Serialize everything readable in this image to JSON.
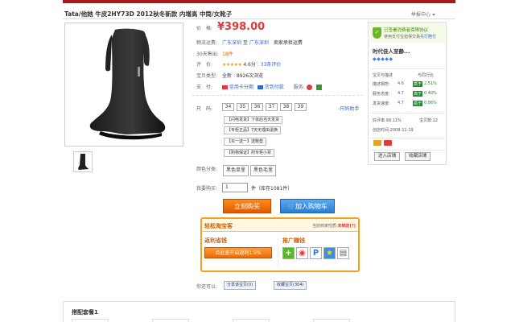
{
  "product": {
    "title": "Tata/他她 牛皮2HY73D 2012秋冬新款 内增高 中筒/女靴子",
    "report": "举报中心"
  },
  "price": {
    "label": "价　格:",
    "value": "¥398.00"
  },
  "shipping": {
    "label": "物流运费:",
    "from": "广东深圳",
    "to_prefix": "至",
    "to": "广东深圳",
    "note": "卖家承担运费"
  },
  "sales": {
    "label": "30天售出:",
    "value": "18件"
  },
  "rating": {
    "label": "评　价:",
    "stars": "★★★★★",
    "score": "4.6分",
    "reviews": "33条评价"
  },
  "points": {
    "label": "宝贝类型:",
    "value": "全新",
    "extra": "8926次浏览"
  },
  "payment": {
    "label": "支　付:",
    "credit": "信用卡分期",
    "installment": "货到付款",
    "service_label": "服务:"
  },
  "size": {
    "label": "尺　码:",
    "options": [
      "34",
      "35",
      "36",
      "37",
      "38",
      "39"
    ],
    "chart_link": "尺码助手"
  },
  "tags": [
    "【闪电发货】下单后当天发货",
    "【专柜正品】7天无理由退换",
    "【买一送一】送鞋垫",
    "【购物保证】附专柜小票"
  ],
  "color": {
    "label": "颜色分类:",
    "options": [
      "黑色单里",
      "黑色毛里"
    ]
  },
  "quantity": {
    "label": "我要购买:",
    "value": "1",
    "stock": "件（库存1081件）"
  },
  "buttons": {
    "buy_now": "立刻购买",
    "add_cart": "加入购物车"
  },
  "promo": {
    "title": "轻松淘宝客",
    "status_prefix": "当前商家性质:",
    "status": "未绑定(?)",
    "rebate_title": "返利省钱",
    "rebate_button": "点此查开启返利1.5%",
    "share_title": "推广赚钱"
  },
  "share": {
    "label": "你还可以:",
    "share_btn": "分享该宝贝(0)",
    "fav_btn": "收藏宝贝(304)"
  },
  "seller": {
    "guarantee_title": "已签署消费者保障协议",
    "guarantee_sub": "使用支付宝担保交易",
    "guarantee_link": "先行赔付",
    "name": "时代佳人至静...",
    "diamonds": "◆◆◆◆◆",
    "header_col1": "宝贝与描述",
    "header_col2": "与同行比",
    "rows": [
      {
        "name": "描述相符:",
        "score": "4.6",
        "badge": "高于",
        "pct": "2.51%"
      },
      {
        "name": "服务态度:",
        "score": "4.7",
        "badge": "高于",
        "pct": "0.40%"
      },
      {
        "name": "发货速度:",
        "score": "4.7",
        "badge": "高于",
        "pct": "0.86%"
      }
    ],
    "rate": "好评率:98.11%",
    "dsr": "宝贝数:12",
    "since": "创店时间:2008-11-19",
    "enter_shop": "进入店铺",
    "fav_shop": "收藏店铺"
  },
  "combo": {
    "title": "搭配套餐1"
  }
}
